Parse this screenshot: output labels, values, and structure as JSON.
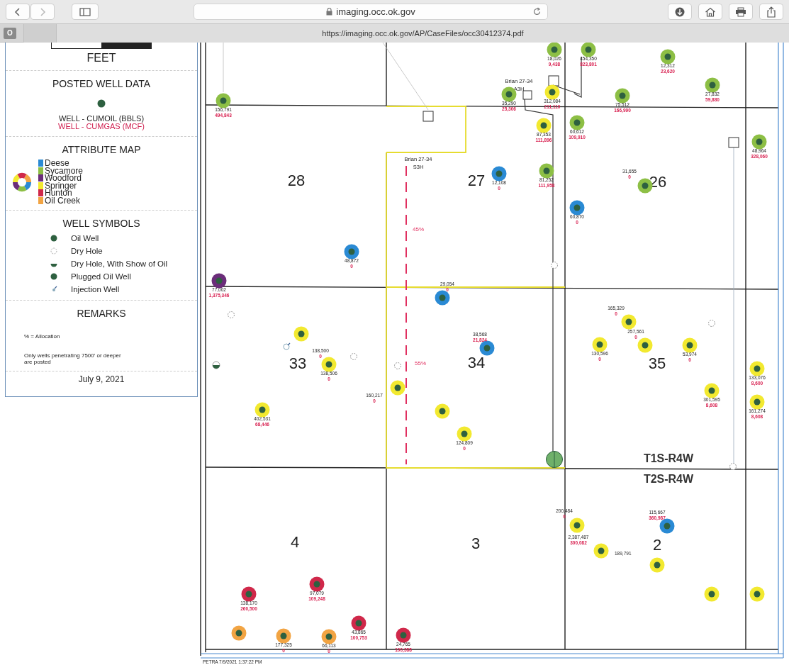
{
  "browser": {
    "address": "imaging.occ.ok.gov",
    "tab_favicon": "O",
    "tab_url": "https://imaging.occ.ok.gov/AP/CaseFiles/occ30412374.pdf"
  },
  "legend": {
    "scale_unit": "FEET",
    "posted_title": "POSTED WELL DATA",
    "cumoil": "WELL - CUMOIL (BBLS)",
    "cumgas": "WELL - CUMGAS (MCF)",
    "attribute_title": "ATTRIBUTE MAP",
    "attribute_map": [
      {
        "label": "Deese",
        "color": "#2a8ad4"
      },
      {
        "label": "Sycamore",
        "color": "#8dbf45"
      },
      {
        "label": "Woodford",
        "color": "#6b2d7a"
      },
      {
        "label": "Springer",
        "color": "#f2e930"
      },
      {
        "label": "Hunton",
        "color": "#d0284a"
      },
      {
        "label": "Oil Creek",
        "color": "#f2a443"
      }
    ],
    "symbols_title": "WELL SYMBOLS",
    "symbols": [
      {
        "kind": "oil",
        "label": "Oil Well"
      },
      {
        "kind": "dry",
        "label": "Dry Hole"
      },
      {
        "kind": "show",
        "label": "Dry Hole, With Show of Oil"
      },
      {
        "kind": "plugged",
        "label": "Plugged Oil Well"
      },
      {
        "kind": "injection",
        "label": "Injection Well"
      }
    ],
    "remarks_title": "REMARKS",
    "remarks": [
      "% = Allocation",
      "Only wells penetrating 7500' or deeper are posted"
    ],
    "date": "July 9, 2021"
  },
  "map": {
    "sections": [
      "28",
      "27",
      "26",
      "33",
      "34",
      "35",
      "4",
      "3",
      "2"
    ],
    "townships": [
      "T1S-R4W",
      "T2S-R4W"
    ],
    "notes": [
      "Brian 27-34",
      "S3H",
      "Brian 27-34",
      "A3H",
      "45%",
      "55%"
    ],
    "wells": [
      {
        "kind": "oil",
        "color": "#8dbf45"
      },
      {
        "kind": "oil",
        "color": "#8dbf45"
      },
      {
        "kind": "oil",
        "color": "#8dbf45"
      },
      {
        "kind": "oil",
        "color": "#8dbf45"
      },
      {
        "kind": "oil",
        "color": "#8dbf45"
      },
      {
        "kind": "oil",
        "color": "#8dbf45"
      },
      {
        "kind": "oil",
        "color": "#8dbf45"
      },
      {
        "kind": "oil",
        "color": "#8dbf45"
      },
      {
        "kind": "oil",
        "color": "#8dbf45"
      },
      {
        "kind": "oil",
        "color": "#8dbf45"
      },
      {
        "kind": "oil",
        "color": "#8dbf45"
      },
      {
        "kind": "oil",
        "color": "#f2e930"
      },
      {
        "kind": "oil",
        "color": "#f2e930"
      },
      {
        "kind": "oil",
        "color": "#2a8ad4"
      },
      {
        "kind": "oil",
        "color": "#2a8ad4"
      },
      {
        "kind": "oil",
        "color": "#2a8ad4"
      },
      {
        "kind": "oil",
        "color": "#2a8ad4"
      },
      {
        "kind": "oil",
        "color": "#2a8ad4"
      },
      {
        "kind": "oil",
        "color": "#2a8ad4"
      },
      {
        "kind": "oil",
        "color": "#6b2d7a"
      },
      {
        "kind": "oil",
        "color": "#f2e930"
      },
      {
        "kind": "oil",
        "color": "#f2e930"
      },
      {
        "kind": "oil",
        "color": "#f2e930"
      },
      {
        "kind": "oil",
        "color": "#f2e930"
      },
      {
        "kind": "oil",
        "color": "#f2e930"
      },
      {
        "kind": "oil",
        "color": "#f2e930"
      },
      {
        "kind": "oil",
        "color": "#f2e930"
      },
      {
        "kind": "oil",
        "color": "#f2e930"
      },
      {
        "kind": "oil",
        "color": "#f2e930"
      },
      {
        "kind": "oil",
        "color": "#f2e930"
      },
      {
        "kind": "oil",
        "color": "#f2e930"
      },
      {
        "kind": "oil",
        "color": "#f2e930"
      },
      {
        "kind": "oil",
        "color": "#f2e930"
      },
      {
        "kind": "plugged",
        "color": "#6fb06a"
      },
      {
        "kind": "oil",
        "color": "#f2e930"
      },
      {
        "kind": "oil",
        "color": "#f2e930"
      },
      {
        "kind": "oil",
        "color": "#f2e930"
      },
      {
        "kind": "oil",
        "color": "#f2e930"
      },
      {
        "kind": "oil",
        "color": "#f2e930"
      },
      {
        "kind": "oil",
        "color": "#d0284a"
      },
      {
        "kind": "oil",
        "color": "#d0284a"
      },
      {
        "kind": "oil",
        "color": "#d0284a"
      },
      {
        "kind": "oil",
        "color": "#d0284a"
      },
      {
        "kind": "oil",
        "color": "#f2a443"
      },
      {
        "kind": "oil",
        "color": "#f2a443"
      },
      {
        "kind": "oil",
        "color": "#f2a443"
      },
      {
        "kind": "dry"
      },
      {
        "kind": "dry"
      },
      {
        "kind": "dry"
      },
      {
        "kind": "dry"
      },
      {
        "kind": "dry"
      },
      {
        "kind": "dry"
      },
      {
        "kind": "show"
      },
      {
        "kind": "injection"
      }
    ],
    "value_labels": [
      {
        "oil": "156,791",
        "gas": "494,843"
      },
      {
        "oil": "18,026",
        "gas": "9,438"
      },
      {
        "oil": "454,350",
        "gas": "823,801"
      },
      {
        "oil": "12,312",
        "gas": "23,620"
      },
      {
        "oil": "27,832",
        "gas": "59,880"
      },
      {
        "oil": "35,290",
        "gas": "25,306"
      },
      {
        "oil": "75,512",
        "gas": "166,990"
      },
      {
        "oil": "60,612",
        "gas": "109,910"
      },
      {
        "oil": "81,252",
        "gas": "111,958"
      },
      {
        "oil": "31,655",
        "gas": "0"
      },
      {
        "oil": "48,964",
        "gas": "328,060"
      },
      {
        "oil": "312,084",
        "gas": "211,110"
      },
      {
        "oil": "87,353",
        "gas": "111,896"
      },
      {
        "oil": "12,108",
        "gas": "0"
      },
      {
        "oil": "60,870",
        "gas": "0"
      },
      {
        "oil": "48,872",
        "gas": "0"
      },
      {
        "oil": "29,054",
        "gas": "0"
      },
      {
        "oil": "38,568",
        "gas": "21,824"
      },
      {
        "oil": "115,667",
        "gas": "360,987"
      },
      {
        "oil": "77,002",
        "gas": "1,375,346"
      },
      {
        "oil": "138,500",
        "gas": "0"
      },
      {
        "oil": "138,506",
        "gas": "0"
      },
      {
        "oil": "402,531",
        "gas": "68,446"
      },
      {
        "oil": "160,217",
        "gas": "0"
      },
      {
        "oil": "124,809",
        "gas": "0"
      },
      {
        "oil": "130,596",
        "gas": "0"
      },
      {
        "oil": "165,329",
        "gas": "0"
      },
      {
        "oil": "257,561",
        "gas": "0"
      },
      {
        "oil": "53,974",
        "gas": "0"
      },
      {
        "oil": "301,595",
        "gas": "8,608"
      },
      {
        "oil": "133,076",
        "gas": "8,600"
      },
      {
        "oil": "161,274",
        "gas": "8,608"
      },
      {
        "oil": "200,484",
        "gas": "0"
      },
      {
        "oil": "2,387,487",
        "gas": "300,082"
      },
      {
        "oil": "138,170",
        "gas": "260,500"
      },
      {
        "oil": "97,079",
        "gas": "109,248"
      },
      {
        "oil": "43,865",
        "gas": "100,753"
      },
      {
        "oil": "177,325",
        "gas": "0"
      },
      {
        "oil": "66,113",
        "gas": "0"
      },
      {
        "oil": "24,765",
        "gas": "100,388"
      }
    ],
    "extra_labels": [
      "189,791"
    ],
    "footer": "PETRA 7/9/2021 1:37:22 PM"
  }
}
